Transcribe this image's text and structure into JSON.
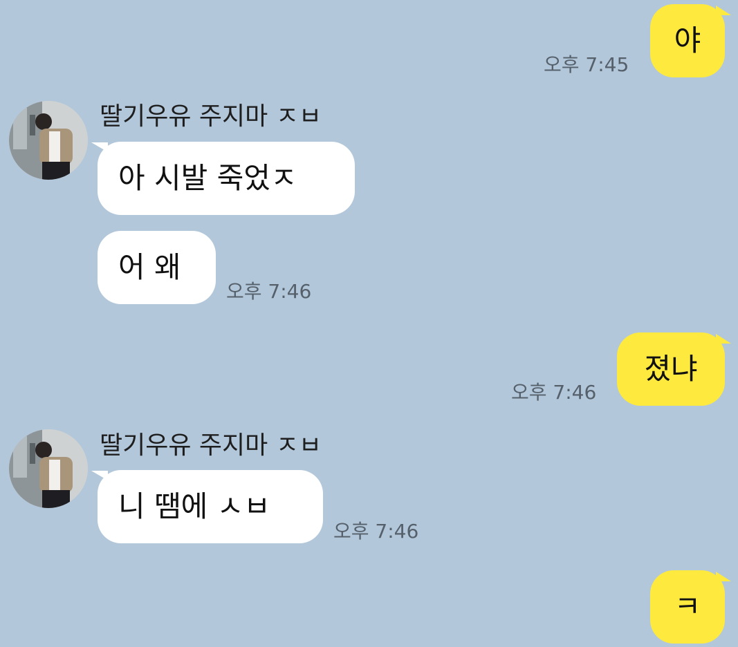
{
  "colors": {
    "background": "#b2c7da",
    "my_bubble": "#fee93f",
    "other_bubble": "#ffffff",
    "time_text": "#55606b"
  },
  "messages": [
    {
      "sender": "me",
      "text": "야",
      "time": "오후 7:45"
    },
    {
      "sender": "other",
      "name": "딸기우유 주지마 ㅈㅂ",
      "avatar": "profile-photo",
      "text": "아 시발 죽었ㅈ",
      "time": ""
    },
    {
      "sender": "other",
      "text": "어 왜",
      "time": "오후 7:46"
    },
    {
      "sender": "me",
      "text": "졌냐",
      "time": "오후 7:46"
    },
    {
      "sender": "other",
      "name": "딸기우유 주지마 ㅈㅂ",
      "avatar": "profile-photo",
      "text": "니 땜에 ㅅㅂ",
      "time": "오후 7:46"
    },
    {
      "sender": "me",
      "text": "ㅋ",
      "time": ""
    }
  ]
}
